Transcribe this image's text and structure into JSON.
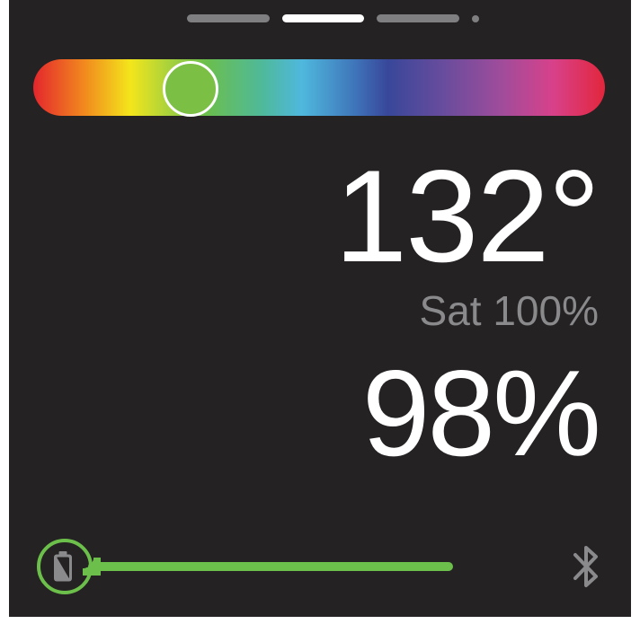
{
  "pager": {
    "pages": 4,
    "active_page": 2
  },
  "hue_slider": {
    "value_fraction": 0.25,
    "knob_color": "#7bbf45"
  },
  "readouts": {
    "hue": "132°",
    "saturation": "Sat 100%",
    "brightness": "98%"
  },
  "status": {
    "battery_icon": "battery-half-icon",
    "level_fraction": 0.98,
    "accent_color": "#6cbf4a",
    "bluetooth_icon": "bluetooth-icon"
  }
}
